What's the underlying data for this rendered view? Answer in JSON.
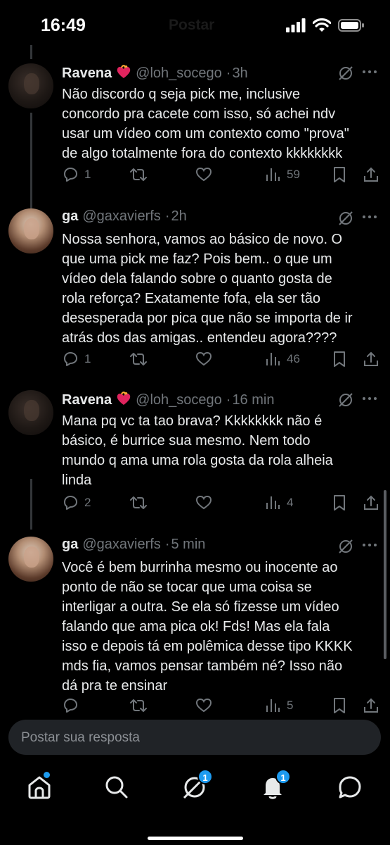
{
  "status_bar": {
    "time": "16:49",
    "header_title": "Postar"
  },
  "tweets": [
    {
      "name": "Ravena",
      "handle": "@loh_socego",
      "time": "3h",
      "text_lines": [
        "Não discordo q seja pick me, inclusive",
        "concordo pra cacete com isso, só achei ndv",
        "usar um vídeo com um contexto como \"prova\"",
        "de algo totalmente fora do contexto kkkkkkkk"
      ],
      "replies": "1",
      "reposts": "",
      "likes": "",
      "views": "59"
    },
    {
      "name": "ga",
      "handle": "@gaxavierfs",
      "time": "2h",
      "text_lines": [
        "Nossa senhora, vamos ao básico de novo. O",
        "que uma pick me faz? Pois bem.. o que um",
        "vídeo dela falando sobre o quanto gosta de",
        "rola reforça? Exatamente fofa, ela ser tão",
        "desesperada por pica que não se importa de ir",
        "atrás dos das amigas.. entendeu agora????"
      ],
      "replies": "1",
      "reposts": "",
      "likes": "",
      "views": "46"
    },
    {
      "name": "Ravena",
      "handle": "@loh_socego",
      "time": "16 min",
      "text_lines": [
        "Mana pq vc ta tao brava? Kkkkkkkk não é",
        "básico, é burrice sua mesmo. Nem todo",
        "mundo q ama uma rola gosta da rola alheia",
        "linda"
      ],
      "replies": "2",
      "reposts": "",
      "likes": "",
      "views": "4"
    },
    {
      "name": "ga",
      "handle": "@gaxavierfs",
      "time": "5 min",
      "text_lines": [
        "Você é bem burrinha mesmo ou inocente ao",
        "ponto de não se tocar que uma coisa se",
        "interligar a outra. Se ela só fizesse um vídeo",
        "falando que ama pica ok! Fds! Mas ela fala",
        "isso e depois tá em polêmica desse tipo KKKK",
        "mds fia, vamos pensar também né? Isso não",
        "dá pra te ensinar"
      ],
      "replies": "",
      "reposts": "",
      "likes": "",
      "views": "5"
    }
  ],
  "reply_bar": {
    "placeholder": "Postar sua resposta"
  },
  "nav": {
    "messages_badge": "1",
    "notifications_badge": "1"
  },
  "colors": {
    "accent": "#1d9bf0",
    "muted": "#71767b",
    "text": "#e7e9ea",
    "background": "#000000"
  }
}
